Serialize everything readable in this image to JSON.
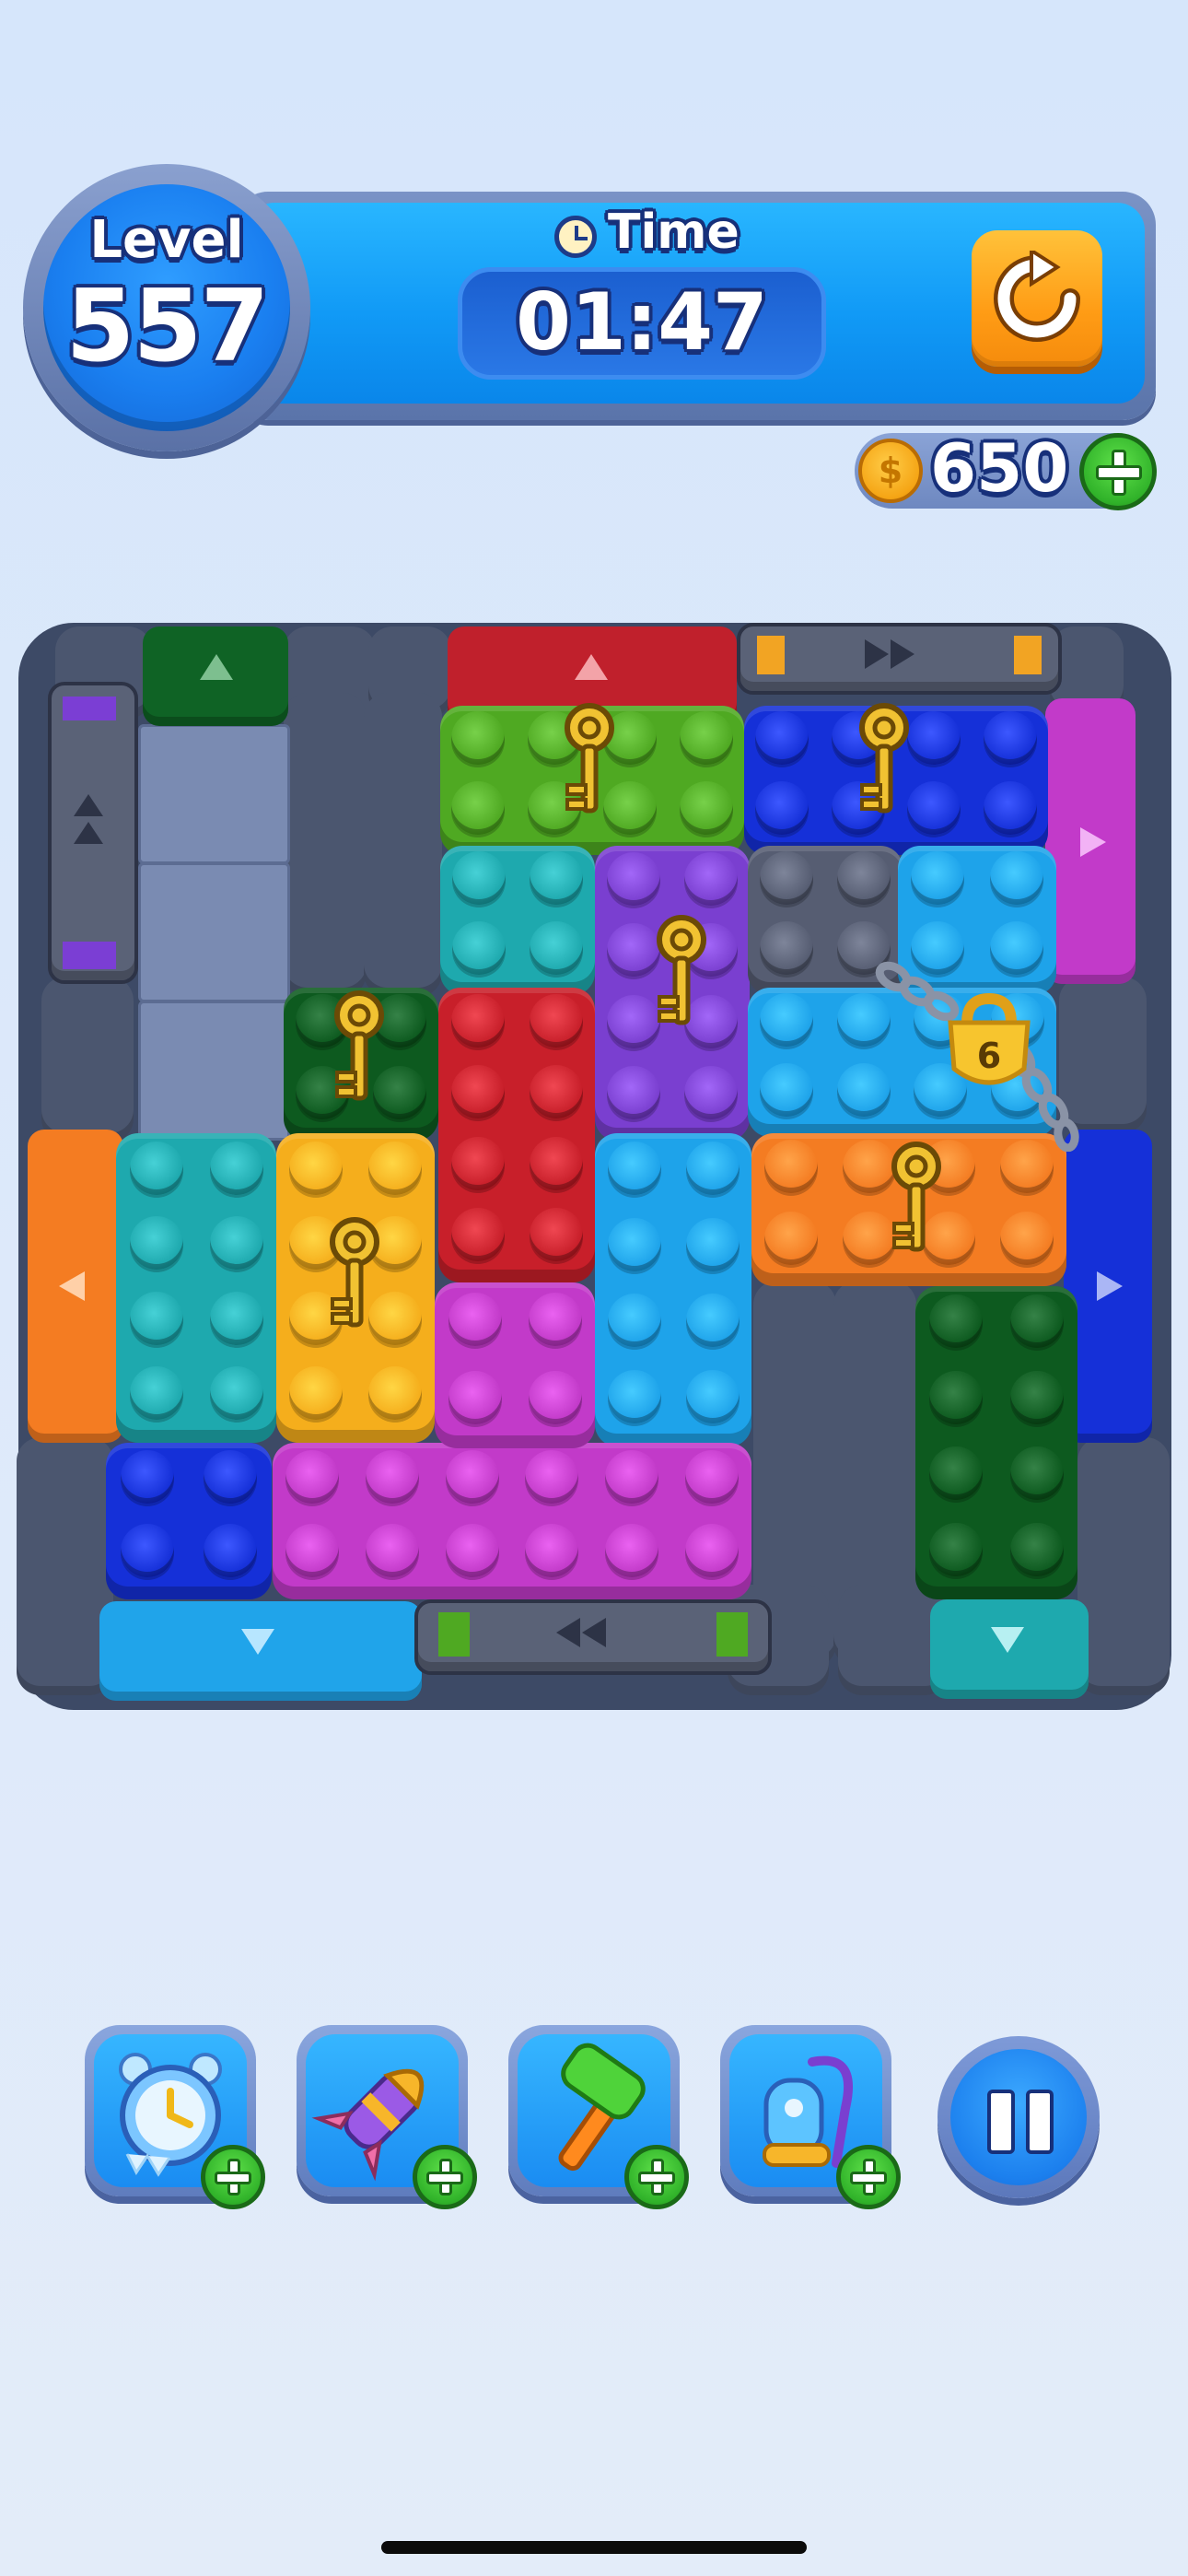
{
  "hud": {
    "level_label": "Level",
    "level_number": "557",
    "time_label": "Time",
    "time_value": "01:47",
    "restart_icon": "restart-arrow-icon",
    "clock_icon": "clock-icon"
  },
  "currency": {
    "coins": "650",
    "coin_icon_glyph": "$",
    "add_icon": "plus-icon"
  },
  "board": {
    "lock_number": "6",
    "keys_count": 6
  },
  "boosters": [
    {
      "name": "freeze-time-booster",
      "icon": "frozen-alarm-clock-icon"
    },
    {
      "name": "rocket-booster",
      "icon": "rocket-icon"
    },
    {
      "name": "hammer-booster",
      "icon": "hammer-icon"
    },
    {
      "name": "vacuum-booster",
      "icon": "vacuum-icon"
    }
  ],
  "colors": {
    "bg": "#dbe7fa",
    "hud_blue": "#119af6",
    "restart_orange": "#ff9c15",
    "green_dark": "#0d5a1f",
    "red": "#c81f2a",
    "lime": "#4fa922",
    "royal_blue": "#1530d8",
    "magenta": "#c23ac9",
    "teal": "#1ea9ae",
    "purple": "#7a3fd0",
    "gray": "#565d72",
    "sky": "#1ea3ea",
    "orange": "#f47c22",
    "yellow": "#f5ae1c"
  }
}
